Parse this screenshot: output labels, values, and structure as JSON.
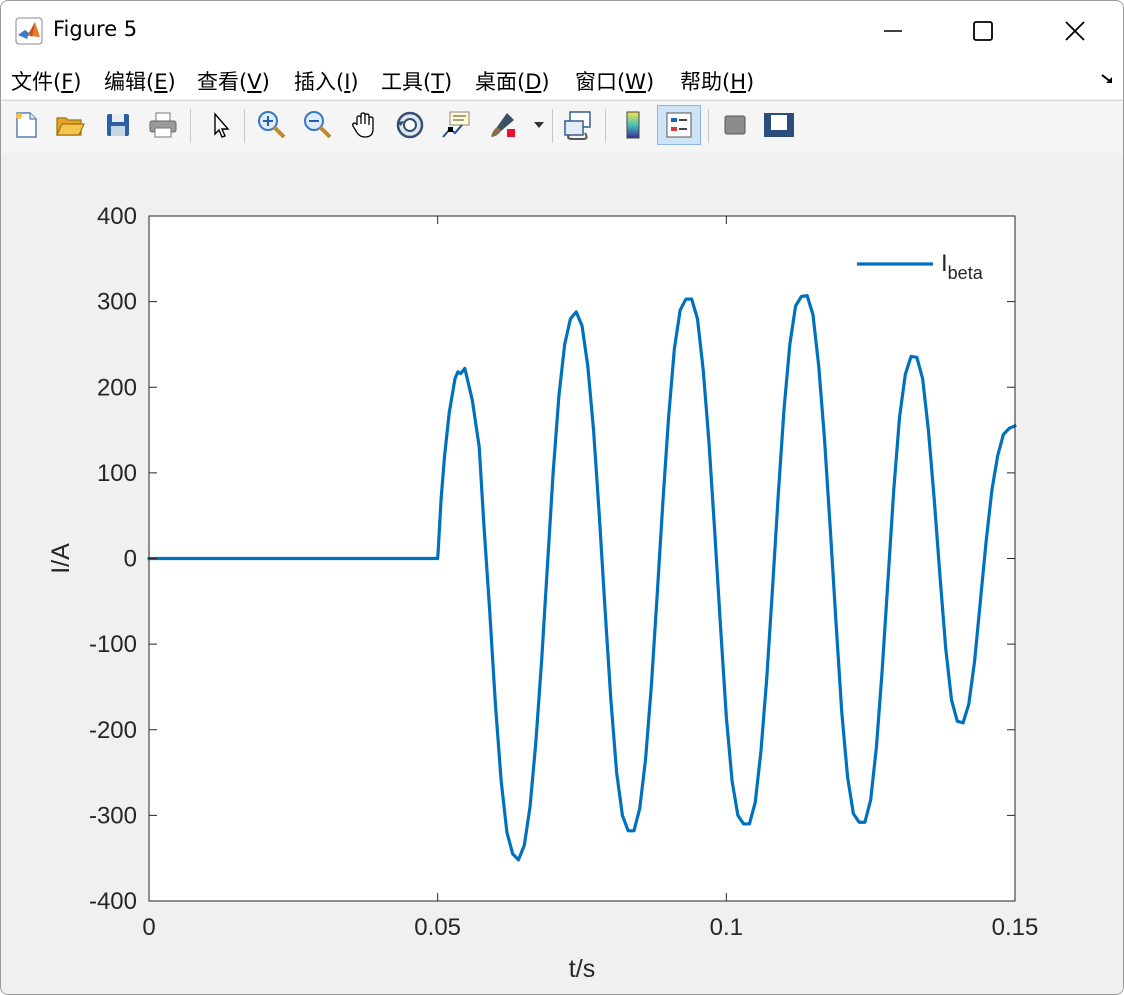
{
  "window": {
    "title": "Figure 5"
  },
  "menu": [
    {
      "label": "文件(",
      "key": "F",
      "tail": ")"
    },
    {
      "label": "编辑(",
      "key": "E",
      "tail": ")"
    },
    {
      "label": "查看(",
      "key": "V",
      "tail": ")"
    },
    {
      "label": "插入(",
      "key": "I",
      "tail": ")"
    },
    {
      "label": "工具(",
      "key": "T",
      "tail": ")"
    },
    {
      "label": "桌面(",
      "key": "D",
      "tail": ")"
    },
    {
      "label": "窗口(",
      "key": "W",
      "tail": ")"
    },
    {
      "label": "帮助(",
      "key": "H",
      "tail": ")"
    }
  ],
  "toolbar": {
    "icons": [
      "new-figure-icon",
      "open-file-icon",
      "save-icon",
      "print-icon",
      "edit-plot-icon",
      "zoom-in-icon",
      "zoom-out-icon",
      "pan-icon",
      "rotate-3d-icon",
      "data-cursor-icon",
      "brush-icon",
      "link-plot-icon",
      "insert-colorbar-icon",
      "insert-legend-icon",
      "hide-plot-tools-icon",
      "show-plot-tools-icon"
    ]
  },
  "chart_data": {
    "type": "line",
    "title": "",
    "xlabel": "t/s",
    "ylabel": "I/A",
    "xlim": [
      0,
      0.15
    ],
    "ylim": [
      -400,
      400
    ],
    "xticks": [
      0,
      0.05,
      0.1,
      0.15
    ],
    "xtick_labels": [
      "0",
      "0.05",
      "0.1",
      "0.15"
    ],
    "yticks": [
      400,
      300,
      200,
      100,
      0,
      -100,
      -200,
      -300,
      -400
    ],
    "ytick_labels": [
      "400",
      "300",
      "200",
      "100",
      "0",
      "-100",
      "-200",
      "-300",
      "-400"
    ],
    "grid": false,
    "legend": {
      "position": "top-right",
      "entries": [
        {
          "base": "I",
          "sub": "beta"
        }
      ]
    },
    "series": [
      {
        "name": "Ibeta",
        "color": "#0072bd",
        "points": [
          [
            0,
            0
          ],
          [
            0.05,
            0
          ],
          [
            0.0501,
            10
          ],
          [
            0.0506,
            70
          ],
          [
            0.0512,
            120
          ],
          [
            0.052,
            170
          ],
          [
            0.053,
            210
          ],
          [
            0.0535,
            218
          ],
          [
            0.054,
            216
          ],
          [
            0.0547,
            222
          ],
          [
            0.0553,
            205
          ],
          [
            0.056,
            185
          ],
          [
            0.0572,
            130
          ],
          [
            0.058,
            40
          ],
          [
            0.059,
            -60
          ],
          [
            0.06,
            -170
          ],
          [
            0.061,
            -260
          ],
          [
            0.062,
            -320
          ],
          [
            0.063,
            -345
          ],
          [
            0.064,
            -352
          ],
          [
            0.065,
            -335
          ],
          [
            0.066,
            -290
          ],
          [
            0.067,
            -215
          ],
          [
            0.068,
            -120
          ],
          [
            0.069,
            -10
          ],
          [
            0.07,
            100
          ],
          [
            0.071,
            190
          ],
          [
            0.072,
            250
          ],
          [
            0.073,
            280
          ],
          [
            0.074,
            288
          ],
          [
            0.075,
            272
          ],
          [
            0.076,
            225
          ],
          [
            0.077,
            150
          ],
          [
            0.078,
            50
          ],
          [
            0.079,
            -60
          ],
          [
            0.08,
            -165
          ],
          [
            0.081,
            -250
          ],
          [
            0.082,
            -300
          ],
          [
            0.083,
            -318
          ],
          [
            0.084,
            -318
          ],
          [
            0.085,
            -292
          ],
          [
            0.086,
            -235
          ],
          [
            0.087,
            -150
          ],
          [
            0.088,
            -45
          ],
          [
            0.089,
            65
          ],
          [
            0.09,
            165
          ],
          [
            0.091,
            245
          ],
          [
            0.092,
            290
          ],
          [
            0.093,
            303
          ],
          [
            0.094,
            303
          ],
          [
            0.095,
            280
          ],
          [
            0.096,
            220
          ],
          [
            0.097,
            135
          ],
          [
            0.098,
            30
          ],
          [
            0.099,
            -80
          ],
          [
            0.1,
            -185
          ],
          [
            0.101,
            -260
          ],
          [
            0.102,
            -300
          ],
          [
            0.103,
            -310
          ],
          [
            0.104,
            -310
          ],
          [
            0.105,
            -285
          ],
          [
            0.106,
            -225
          ],
          [
            0.107,
            -140
          ],
          [
            0.108,
            -35
          ],
          [
            0.109,
            75
          ],
          [
            0.11,
            175
          ],
          [
            0.111,
            250
          ],
          [
            0.112,
            295
          ],
          [
            0.113,
            306
          ],
          [
            0.114,
            307
          ],
          [
            0.115,
            285
          ],
          [
            0.116,
            225
          ],
          [
            0.117,
            140
          ],
          [
            0.118,
            35
          ],
          [
            0.119,
            -75
          ],
          [
            0.12,
            -180
          ],
          [
            0.121,
            -255
          ],
          [
            0.122,
            -298
          ],
          [
            0.123,
            -308
          ],
          [
            0.124,
            -308
          ],
          [
            0.125,
            -282
          ],
          [
            0.126,
            -220
          ],
          [
            0.127,
            -130
          ],
          [
            0.128,
            -25
          ],
          [
            0.129,
            80
          ],
          [
            0.13,
            165
          ],
          [
            0.131,
            215
          ],
          [
            0.132,
            236
          ],
          [
            0.133,
            235
          ],
          [
            0.134,
            210
          ],
          [
            0.135,
            150
          ],
          [
            0.136,
            70
          ],
          [
            0.137,
            -20
          ],
          [
            0.138,
            -105
          ],
          [
            0.139,
            -165
          ],
          [
            0.14,
            -190
          ],
          [
            0.141,
            -192
          ],
          [
            0.142,
            -170
          ],
          [
            0.143,
            -120
          ],
          [
            0.144,
            -50
          ],
          [
            0.145,
            20
          ],
          [
            0.146,
            80
          ],
          [
            0.147,
            120
          ],
          [
            0.148,
            145
          ],
          [
            0.149,
            152
          ],
          [
            0.15,
            155
          ]
        ]
      }
    ]
  }
}
